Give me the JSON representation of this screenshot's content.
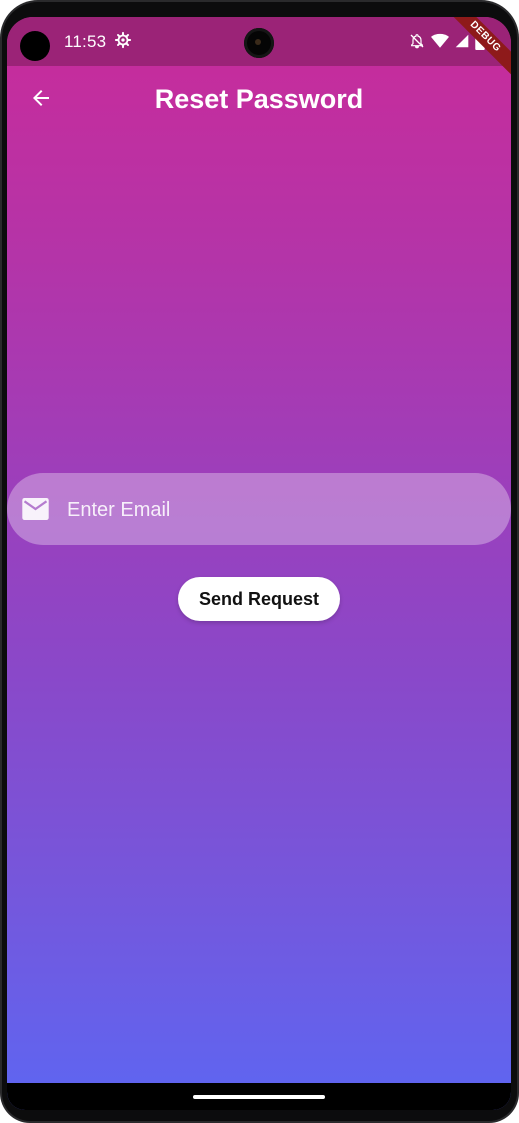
{
  "status_bar": {
    "time": "11:53",
    "icons": [
      "gear-icon",
      "bell-off-icon",
      "wifi-icon",
      "signal-icon",
      "battery-icon"
    ]
  },
  "debug_banner": "DEBUG",
  "app_bar": {
    "title": "Reset Password",
    "back_icon": "arrow-back-icon"
  },
  "form": {
    "email_placeholder": "Enter Email",
    "email_value": "",
    "email_icon": "mail-icon",
    "send_label": "Send Request"
  },
  "colors": {
    "gradient_top": "#c92b9a",
    "gradient_bottom": "#5d66f2",
    "status_bar": "#9b2377",
    "debug_ribbon": "#8e1a1a"
  }
}
